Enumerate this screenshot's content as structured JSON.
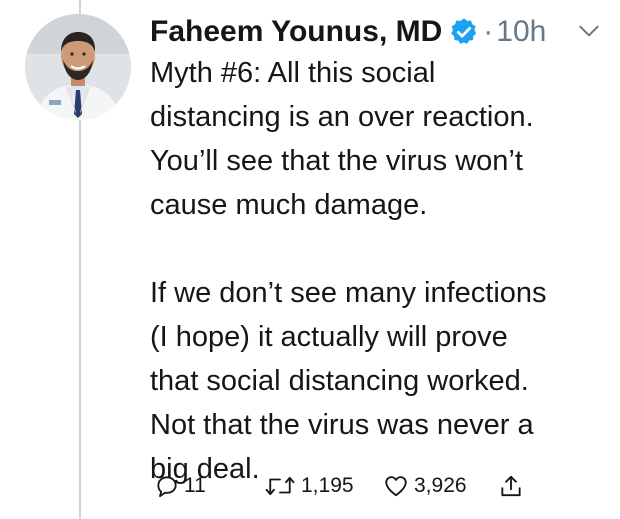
{
  "tweet": {
    "author_name": "Faheem Younus, MD",
    "separator": "·",
    "timestamp": "10h",
    "paragraphs": [
      "Myth #6: All this social\ndistancing is an over reaction.\nYou’ll see that the virus won’t\ncause much damage.",
      "If we don’t see many infections\n(I hope) it actually will prove\nthat social distancing worked.\nNot that the virus was never a\nbig deal."
    ],
    "reply_count": "11",
    "retweet_count": "1,195",
    "like_count": "3,926"
  },
  "icons": {
    "verified": "verified-badge-icon",
    "caret": "chevron-down-icon",
    "reply": "reply-icon",
    "retweet": "retweet-icon",
    "like": "heart-icon",
    "share": "share-icon"
  },
  "colors": {
    "verified_blue": "#1da1f2",
    "secondary_text": "#657786",
    "thread_line": "#ccd6dd",
    "text": "#14171a"
  }
}
